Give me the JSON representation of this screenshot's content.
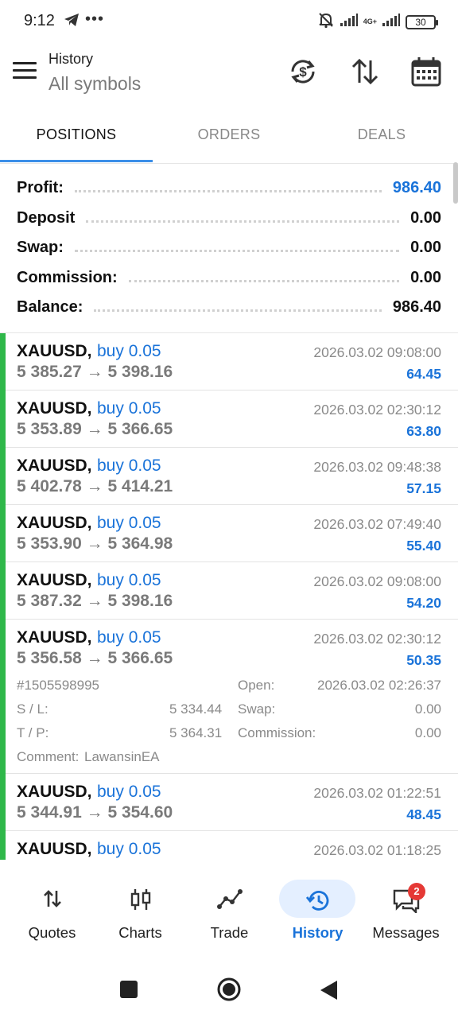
{
  "status_bar": {
    "time": "9:12",
    "network": "4G+",
    "battery": "30"
  },
  "app_bar": {
    "title": "History",
    "subtitle": "All symbols",
    "icons": [
      "menu-icon",
      "currency-exchange-icon",
      "sort-icon",
      "calendar-icon"
    ]
  },
  "tabs": [
    {
      "label": "POSITIONS",
      "active": true
    },
    {
      "label": "ORDERS",
      "active": false
    },
    {
      "label": "DEALS",
      "active": false
    }
  ],
  "summary": {
    "profit_label": "Profit:",
    "profit": "986.40",
    "deposit_label": "Deposit",
    "deposit": "0.00",
    "swap_label": "Swap:",
    "swap": "0.00",
    "commission_label": "Commission:",
    "commission": "0.00",
    "balance_label": "Balance:",
    "balance": "986.40"
  },
  "trades": [
    {
      "symbol": "XAUUSD,",
      "side": "buy 0.05",
      "open_price": "5 385.27",
      "close_price": "5 398.16",
      "time": "2026.03.02 09:08:00",
      "profit": "64.45"
    },
    {
      "symbol": "XAUUSD,",
      "side": "buy 0.05",
      "open_price": "5 353.89",
      "close_price": "5 366.65",
      "time": "2026.03.02 02:30:12",
      "profit": "63.80"
    },
    {
      "symbol": "XAUUSD,",
      "side": "buy 0.05",
      "open_price": "5 402.78",
      "close_price": "5 414.21",
      "time": "2026.03.02 09:48:38",
      "profit": "57.15"
    },
    {
      "symbol": "XAUUSD,",
      "side": "buy 0.05",
      "open_price": "5 353.90",
      "close_price": "5 364.98",
      "time": "2026.03.02 07:49:40",
      "profit": "55.40"
    },
    {
      "symbol": "XAUUSD,",
      "side": "buy 0.05",
      "open_price": "5 387.32",
      "close_price": "5 398.16",
      "time": "2026.03.02 09:08:00",
      "profit": "54.20"
    },
    {
      "symbol": "XAUUSD,",
      "side": "buy 0.05",
      "open_price": "5 356.58",
      "close_price": "5 366.65",
      "time": "2026.03.02 02:30:12",
      "profit": "50.35"
    },
    {
      "symbol": "XAUUSD,",
      "side": "buy 0.05",
      "open_price": "5 344.91",
      "close_price": "5 354.60",
      "time": "2026.03.02 01:22:51",
      "profit": "48.45"
    },
    {
      "symbol": "XAUUSD,",
      "side": "buy 0.05",
      "open_price": "",
      "close_price": "",
      "time": "2026.03.02 01:18:25",
      "profit": ""
    }
  ],
  "arrow": "→",
  "expanded_detail": {
    "ticket": "#1505598995",
    "open_label": "Open:",
    "open_time": "2026.03.02 02:26:37",
    "sl_label": "S / L:",
    "sl": "5 334.44",
    "swap_label": "Swap:",
    "swap": "0.00",
    "tp_label": "T / P:",
    "tp": "5 364.31",
    "commission_label": "Commission:",
    "commission": "0.00",
    "comment_label": "Comment:",
    "comment": "LawansinEA"
  },
  "bottom_nav": [
    {
      "label": "Quotes",
      "icon": "quotes-icon",
      "active": false
    },
    {
      "label": "Charts",
      "icon": "charts-icon",
      "active": false
    },
    {
      "label": "Trade",
      "icon": "trade-icon",
      "active": false
    },
    {
      "label": "History",
      "icon": "history-icon",
      "active": true
    },
    {
      "label": "Messages",
      "icon": "messages-icon",
      "active": false
    }
  ],
  "messages_badge": "2",
  "colors": {
    "accent": "#1a73d9",
    "buy_bar": "#2fb84a",
    "tab_underline": "#3b8ee8",
    "badge": "#e53935"
  }
}
